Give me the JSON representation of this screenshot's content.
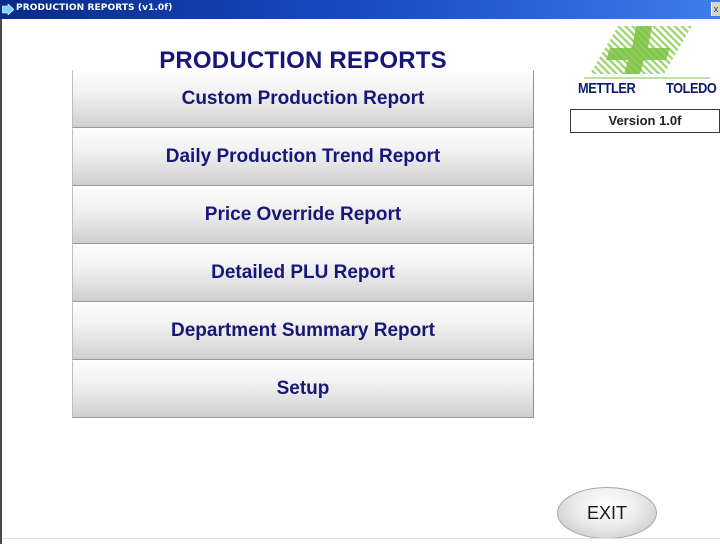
{
  "window": {
    "title": "PRODUCTION REPORTS (v1.0f)",
    "close_glyph": "x",
    "title_icon": "app-arrow-icon"
  },
  "main": {
    "title": "PRODUCTION REPORTS",
    "buttons": [
      {
        "label": "Custom Production Report"
      },
      {
        "label": "Daily Production Trend Report"
      },
      {
        "label": "Price Override Report"
      },
      {
        "label": "Detailed PLU Report"
      },
      {
        "label": "Department Summary Report"
      },
      {
        "label": "Setup"
      }
    ]
  },
  "brand": {
    "word_left": "METTLER",
    "word_right": "TOLEDO",
    "logo_green": "#7cc242",
    "logo_blue": "#0a1b6a"
  },
  "version": {
    "label": "Version 1.0f"
  },
  "exit": {
    "label": "EXIT"
  },
  "colors": {
    "accent_text": "#17177a",
    "titlebar": "#1a4fc8"
  }
}
